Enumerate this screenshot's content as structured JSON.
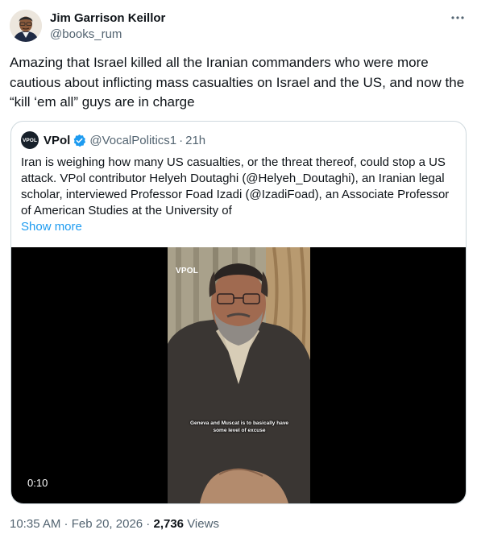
{
  "author": {
    "name": "Jim Garrison Keillor",
    "handle": "@books_rum"
  },
  "tweet": {
    "text": "Amazing that Israel killed all the Iranian commanders who were more cautious about inflicting mass casualties on Israel and the US, and now the “kill ‘em all” guys are in charge"
  },
  "quote": {
    "avatar_text": "VPOL",
    "name": "VPol",
    "handle": "@VocalPolitics1",
    "separator": "·",
    "time": "21h",
    "text": "Iran is weighing how many US casualties, or the threat thereof, could stop a US attack. VPol contributor Helyeh Doutaghi (@Helyeh_Doutaghi), an Iranian legal scholar, interviewed Professor Foad Izadi (@IzadiFoad), an Associate Professor of American Studies at the University of",
    "show_more": "Show more",
    "video": {
      "duration": "0:10",
      "logo": "VPOL",
      "caption": "Geneva and Muscat is to basically have some level of excuse"
    }
  },
  "meta": {
    "time": "10:35 AM",
    "sep1": " · ",
    "date": "Feb 20, 2026",
    "sep2": " · ",
    "views_count": "2,736",
    "views_label": "Views"
  },
  "colors": {
    "text": "#0f1419",
    "muted": "#536471",
    "link": "#1d9bf0",
    "border": "#cfd9de",
    "verified": "#1d9bf0"
  },
  "icons": {
    "more": "more-horizontal-icon",
    "verified": "verified-badge-icon"
  }
}
